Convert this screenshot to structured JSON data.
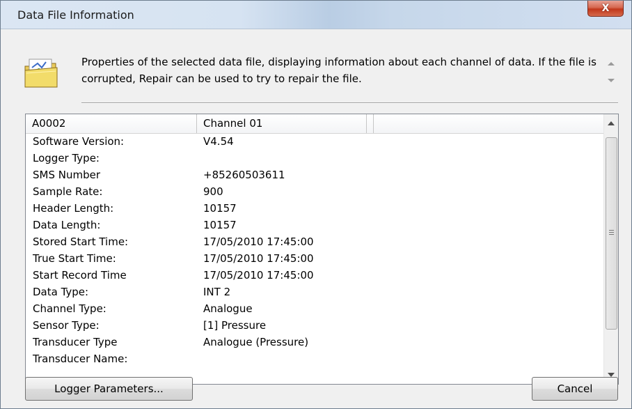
{
  "window": {
    "title": "Data File Information",
    "close_label": "X"
  },
  "description": "Properties of the selected data file, displaying information about each channel of data. If the file is corrupted, Repair can be used to try to repair the file.",
  "icon": "folder-properties-icon",
  "list": {
    "columns": [
      "A0002",
      "Channel 01",
      ""
    ],
    "rows": [
      {
        "key": "Software Version:",
        "value": "V4.54"
      },
      {
        "key": "Logger Type:",
        "value": ""
      },
      {
        "key": "SMS Number",
        "value": "+85260503611"
      },
      {
        "key": "Sample Rate:",
        "value": "900"
      },
      {
        "key": "Header Length:",
        "value": "10157"
      },
      {
        "key": "Data Length:",
        "value": "10157"
      },
      {
        "key": "Stored Start Time:",
        "value": "17/05/2010 17:45:00"
      },
      {
        "key": "True Start Time:",
        "value": "17/05/2010 17:45:00"
      },
      {
        "key": "Start Record Time",
        "value": "17/05/2010 17:45:00"
      },
      {
        "key": "Data Type:",
        "value": "INT 2"
      },
      {
        "key": "Channel Type:",
        "value": "Analogue"
      },
      {
        "key": "Sensor Type:",
        "value": "[1] Pressure"
      },
      {
        "key": "Transducer Type",
        "value": "Analogue (Pressure)"
      },
      {
        "key": "Transducer Name:",
        "value": ""
      }
    ]
  },
  "buttons": {
    "logger_parameters": "Logger Parameters...",
    "cancel": "Cancel"
  },
  "colors": {
    "close_button": "#c2371b",
    "title_bar": "#d6e3f2",
    "dialog_bg": "#f0f0f0"
  }
}
